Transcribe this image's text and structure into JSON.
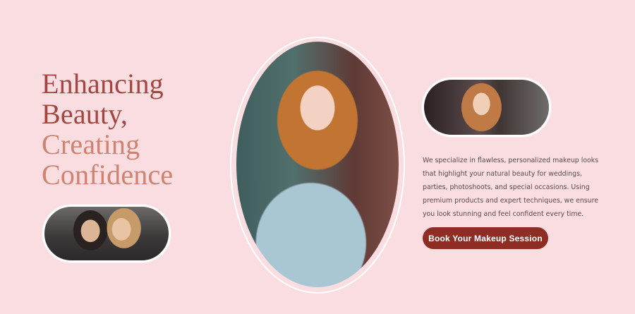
{
  "hero": {
    "headline_lines": [
      "Enhancing",
      "Beauty,",
      "Creating",
      "Confidence"
    ],
    "description": "We specialize in flawless, personalized makeup looks that highlight your natural beauty for weddings, parties, photoshoots, and special occasions. Using premium products and expert techniques, we ensure you look stunning and feel confident every time.",
    "cta_label": "Book Your Makeup Session"
  },
  "colors": {
    "background": "#f9dde1",
    "headline_dark": "#a3463f",
    "headline_light": "#d08170",
    "button": "#8d2d24"
  }
}
